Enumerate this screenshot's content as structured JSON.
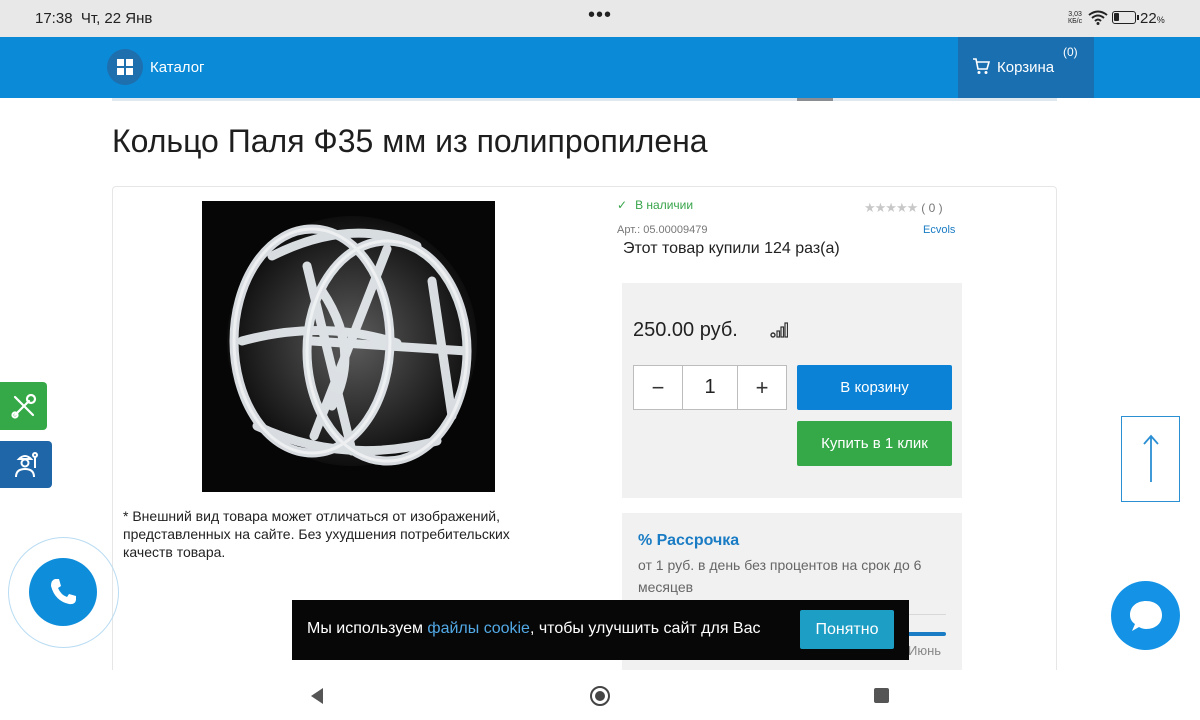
{
  "status_bar": {
    "time": "17:38",
    "date": "Чт, 22 Янв",
    "menu_dots": "•••",
    "net_speed": "3,03",
    "net_unit": "КБ/с",
    "battery": "22",
    "battery_unit": "%"
  },
  "header": {
    "catalog_label": "Каталог",
    "cart_label": "Корзина",
    "cart_count": "(0)"
  },
  "product": {
    "title": "Кольцо Паля Ф35 мм из полипропилена",
    "stock": "В наличии",
    "rating_stars": "★★★★★",
    "rating_count": "( 0 )",
    "article": "Арт.: 05.00009479",
    "brand": "Ecvols",
    "bought_text": "Этот товар купили 124 раз(а)",
    "disclaimer": "* Внешний вид товара может отличаться от изображений, представленных на сайте. Без ухудшения потребительских качеств товара.",
    "price": "250.00 руб.",
    "quantity": "1",
    "minus": "−",
    "plus": "+",
    "add_to_cart": "В корзину",
    "buy_one_click": "Купить в 1 клик"
  },
  "installment": {
    "title": "% Рассрочка",
    "description": "от 1 руб. в день без процентов на срок до 6 месяцев",
    "month": "Июнь"
  },
  "cookie": {
    "text_before": "Мы используем ",
    "link": "файлы cookie",
    "text_after": ", чтобы улучшить сайт для Вас",
    "accept": "Понятно"
  },
  "colors": {
    "nav_blue": "#0b8ad8",
    "cart_dark_blue": "#1a6fb0",
    "green": "#35a948",
    "link_blue": "#1a7cc4"
  },
  "icons": {
    "catalog": "grid-icon",
    "cart": "cart-icon",
    "stock": "check-icon",
    "compare": "bar-chart-icon",
    "tools": "wrench-screwdriver-icon",
    "master": "worker-icon",
    "phone": "phone-icon",
    "scroll_up": "arrow-up-icon",
    "chat": "chat-bubble-icon"
  }
}
